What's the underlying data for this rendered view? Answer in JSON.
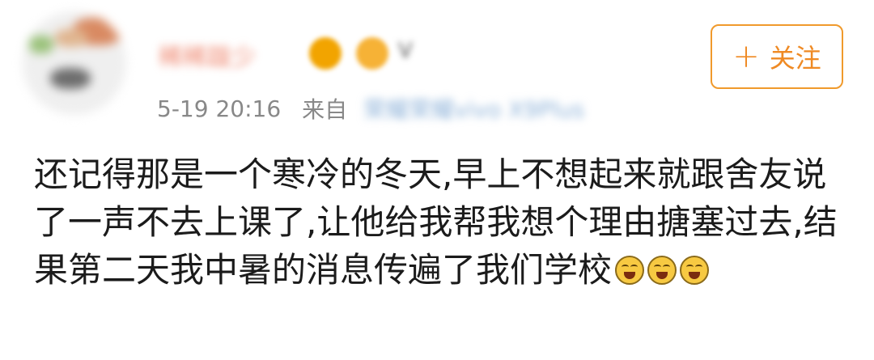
{
  "post": {
    "username": "稀稀跋少",
    "vip_mark": "V",
    "timestamp": "5-19 20:16",
    "source_prefix": "来自",
    "source_device": "荣耀荣耀vivo X9Plus",
    "content": "还记得那是一个寒冷的冬天,早上不想起来就跟舍友说了一声不去上课了,让他给我帮我想个理由搪塞过去,结果第二天我中暑的消息传遍了我们学校",
    "emojis": [
      "laugh-cry-icon",
      "laugh-cry-icon",
      "laugh-cry-icon"
    ]
  },
  "follow_button": {
    "plus_glyph": "+",
    "label": "关注"
  },
  "colors": {
    "accent": "#ef8a24",
    "meta_text": "#888888",
    "content_text": "#1b1b1b"
  }
}
